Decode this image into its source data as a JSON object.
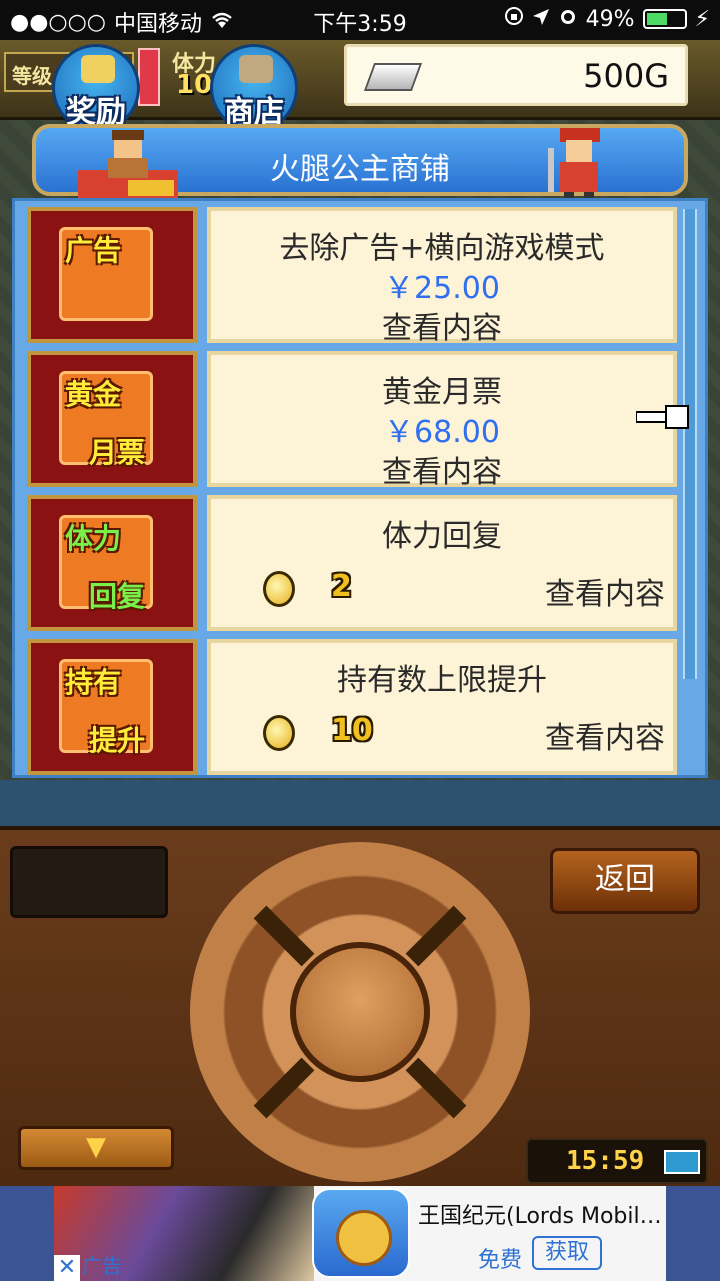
{
  "status_bar": {
    "signal": "●●○○○",
    "carrier": "中国移动",
    "time": "下午3:59",
    "battery": "49%"
  },
  "top_bar": {
    "level_label": "等级",
    "stamina_label": "体力",
    "stamina_value": "10",
    "reward_label": "奖励",
    "shop_label": "商店",
    "gold": "500G"
  },
  "shop": {
    "title": "火腿公主商铺",
    "items": [
      {
        "thumb_top": "广告",
        "thumb_bottom": "",
        "name": "去除广告+横向游戏模式",
        "price": "￥25.00",
        "view": "查看内容"
      },
      {
        "thumb_top": "黄金",
        "thumb_bottom": "月票",
        "name": "黄金月票",
        "price": "￥68.00",
        "view": "查看内容"
      },
      {
        "thumb_top": "体力",
        "thumb_bottom": "回复",
        "name": "体力回复",
        "coins": "2",
        "view": "查看内容"
      },
      {
        "thumb_top": "持有",
        "thumb_bottom": "提升",
        "name": "持有数上限提升",
        "coins": "10",
        "view": "查看内容"
      }
    ]
  },
  "controls": {
    "back_label": "返回",
    "down_arrow": "▼",
    "clock_time": "15:59"
  },
  "ad": {
    "close": "✕",
    "label": "广告",
    "title": "王国纪元(Lords Mobil…",
    "free": "免费",
    "get": "获取"
  },
  "colors": {
    "price_blue": "#2f6ff0",
    "card_bg": "#fdf3d6",
    "panel_blue": "#68a8e6",
    "thumb_red": "#8a1212"
  }
}
